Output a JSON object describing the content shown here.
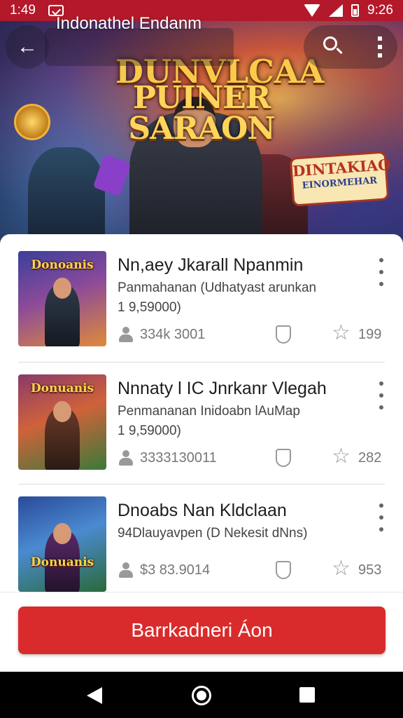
{
  "status_bar": {
    "time": "1:49",
    "clock_right": "9:26"
  },
  "app_bar": {
    "title": "Indonathel Endanm"
  },
  "hero": {
    "top_title": "DUNVLCAA",
    "title": "PUINER SARAON",
    "badge_line1": "DINTAKIAO",
    "badge_line2": "EINORMEHAR"
  },
  "items": [
    {
      "thumb_title": "Donoanis",
      "title": "Nn,aey Jkarall Npanmin",
      "subtitle": "Panmahanan (Udhatyast arunkan",
      "price": "1 9,59000)",
      "count": "334k 3001",
      "rating": "199"
    },
    {
      "thumb_title": "Donuanis",
      "title": "Nnnaty l IC Jnrkanr Vlegah",
      "subtitle": "Penmananan Inidoabn lAuMap",
      "price": "1 9,59000)",
      "count": "3333130011",
      "rating": "282"
    },
    {
      "thumb_title": "Donuanis",
      "title": "Dnoabs Nan Kldclaan",
      "subtitle": "94Dlauyavpen (D Nekesit dNns)",
      "price": "",
      "count": "$3 83.9014",
      "rating": "953"
    }
  ],
  "bottom": {
    "action_label": "Barrkadneri Áon"
  },
  "colors": {
    "status_bar": "#b3192a",
    "primary": "#d92b2c"
  }
}
